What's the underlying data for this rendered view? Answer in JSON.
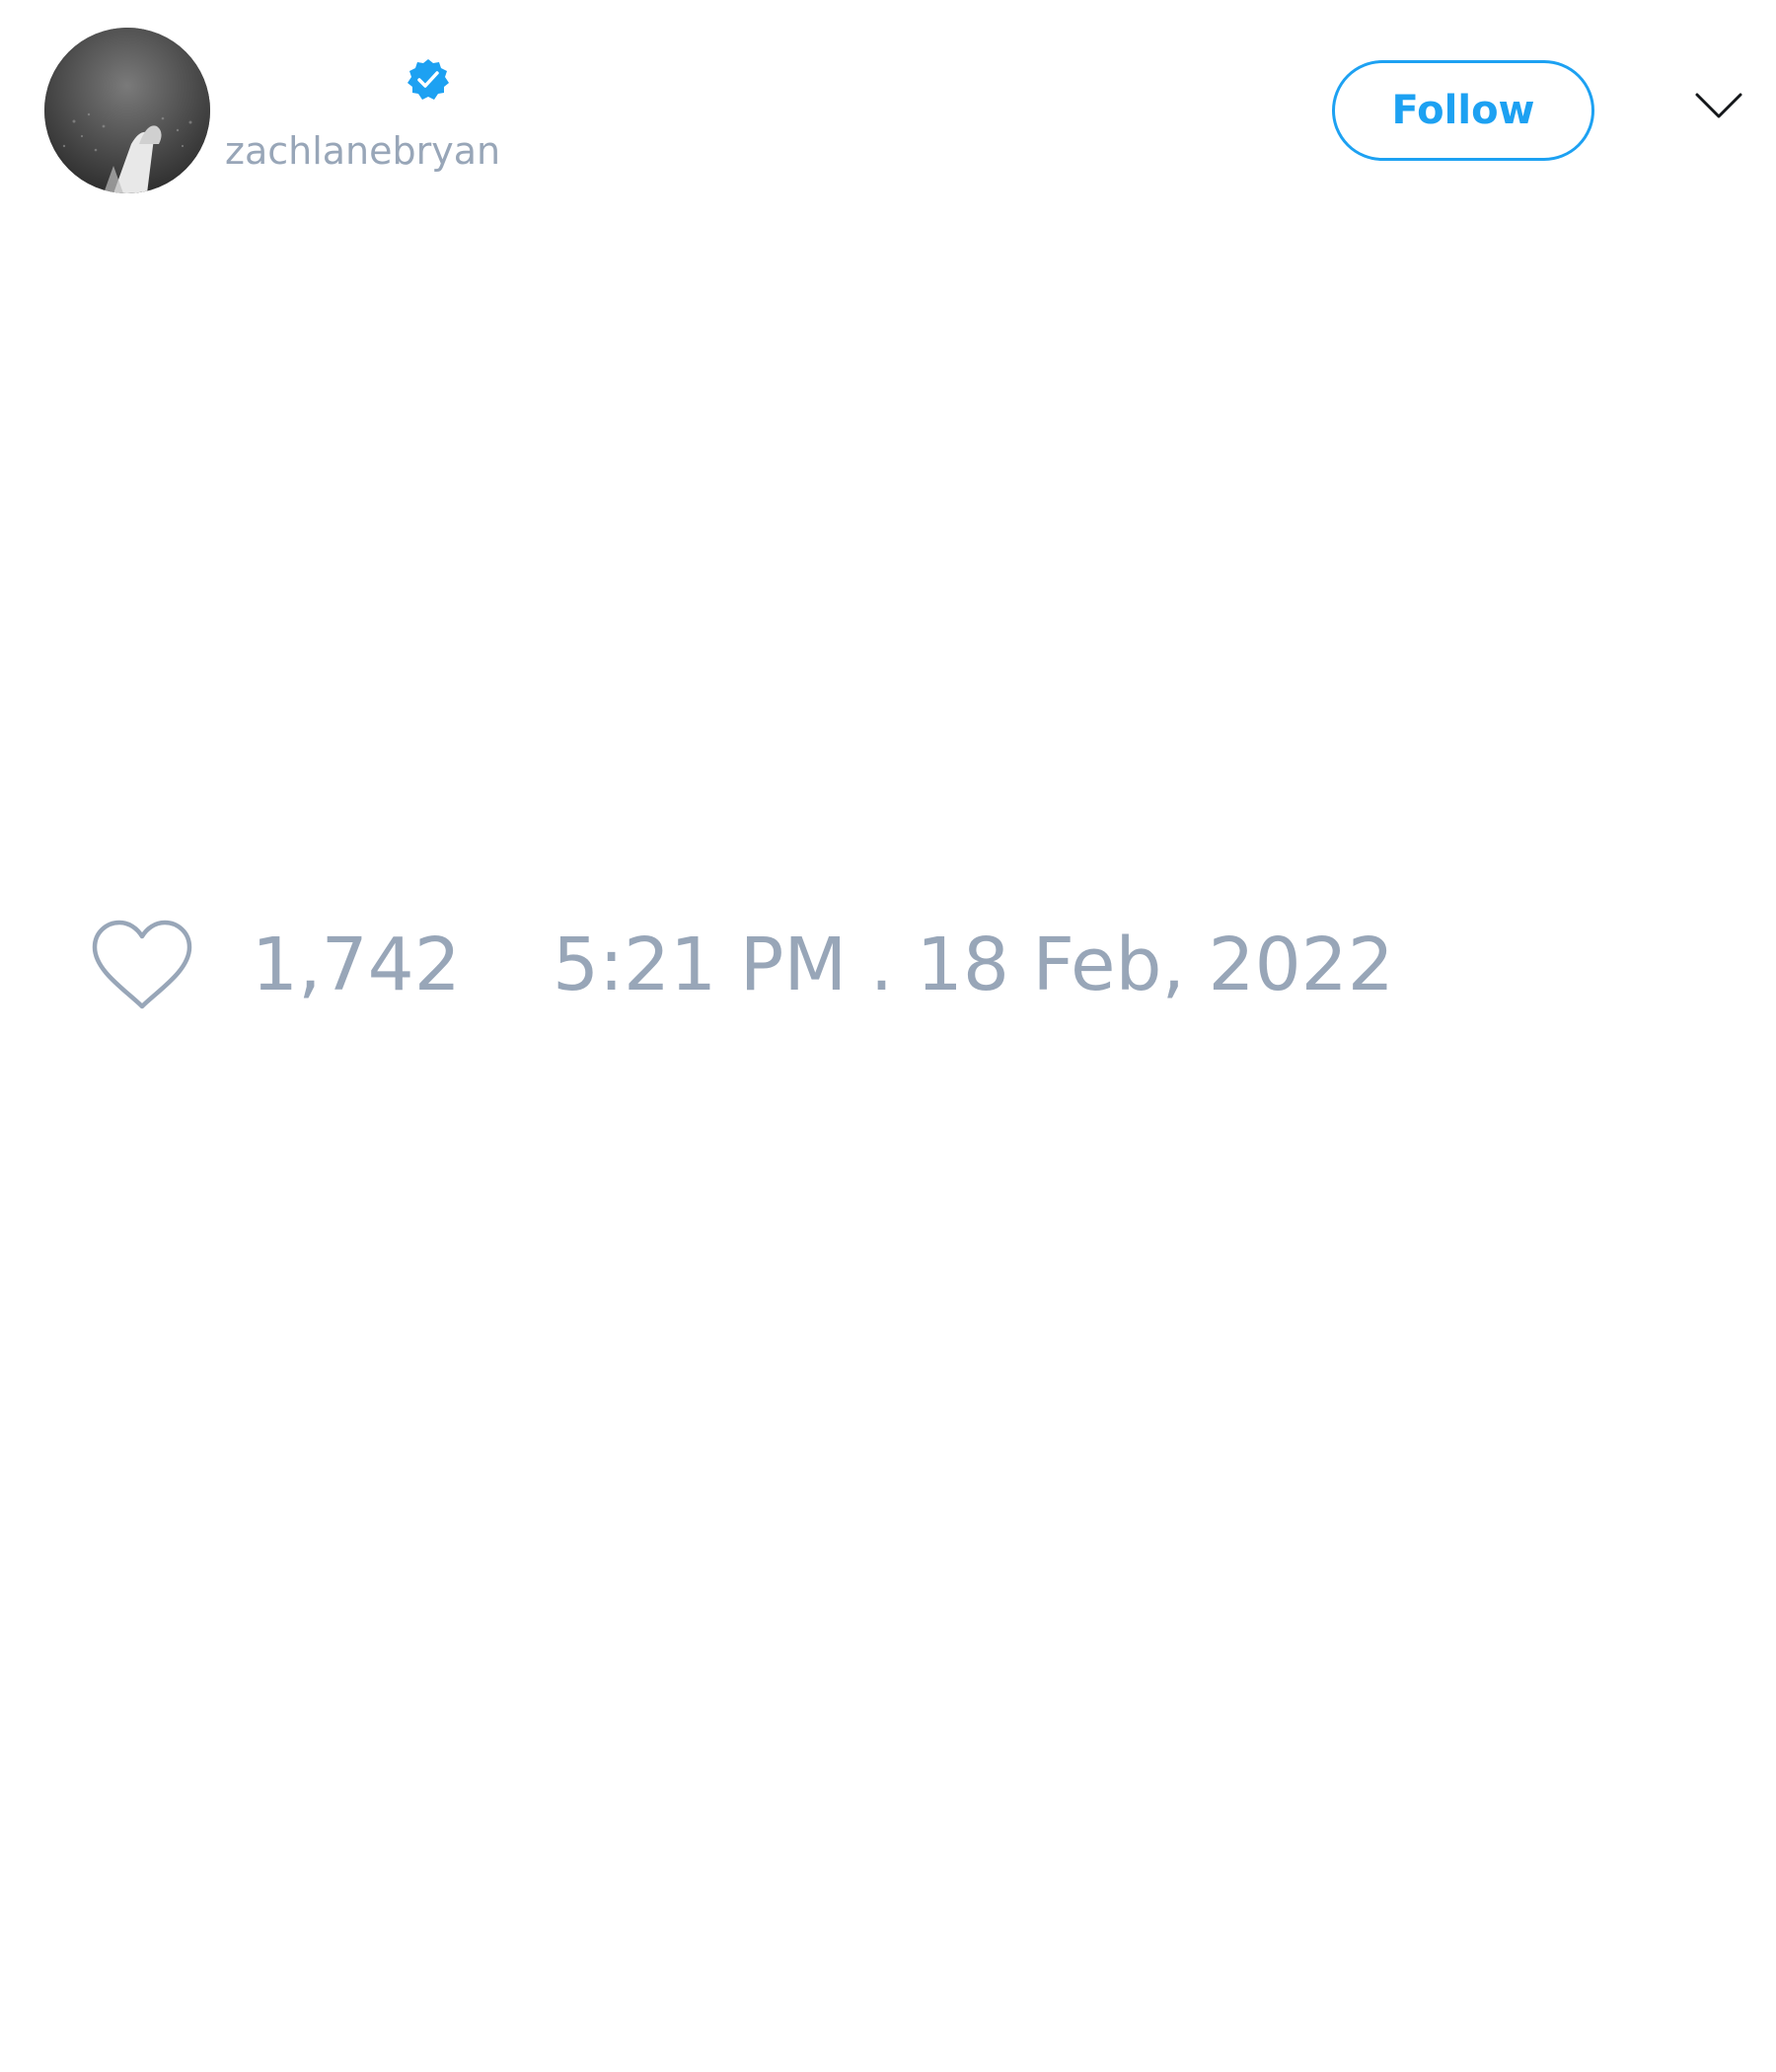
{
  "tweet": {
    "author": {
      "display_name": "",
      "username": "zachlanebryan",
      "verified": true,
      "avatar_icon": "avatar-photo"
    },
    "follow_label": "Follow",
    "menu_icon": "chevron-down-icon",
    "text": "",
    "likes": "1,742",
    "timestamp": "5:21 PM . 18 Feb, 2022"
  },
  "colors": {
    "accent": "#1da1f2",
    "muted_text": "#98a6b8",
    "background": "#ffffff"
  }
}
